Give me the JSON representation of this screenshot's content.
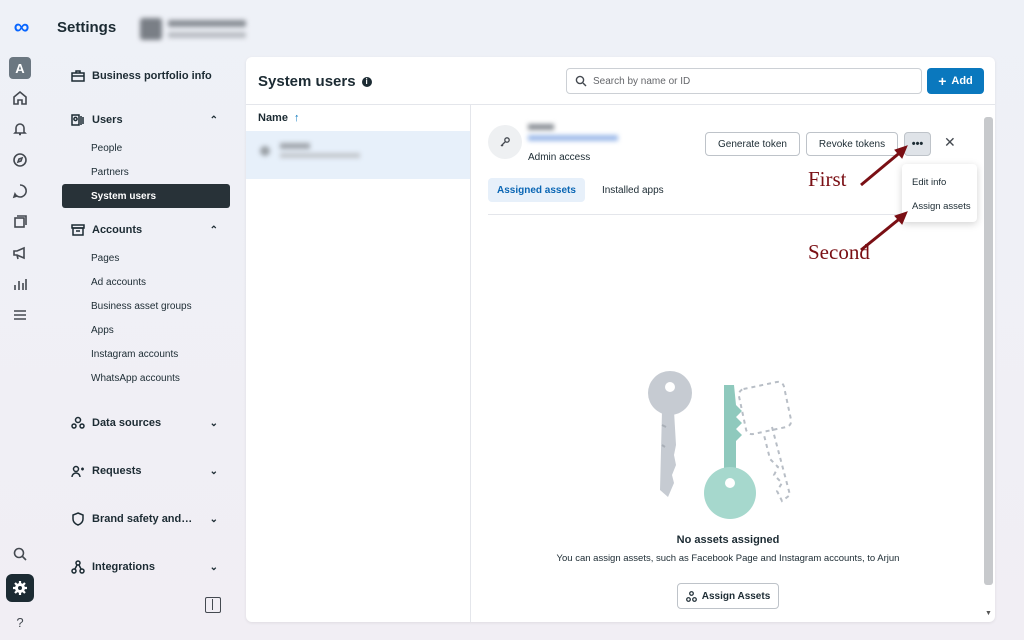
{
  "header": {
    "title": "Settings"
  },
  "sidenav": {
    "sections": [
      {
        "label": "Business portfolio info",
        "icon": "briefcase-icon",
        "chevron": ""
      },
      {
        "label": "Users",
        "icon": "users-icon",
        "chevron": "⌃",
        "items": [
          "People",
          "Partners",
          "System users"
        ]
      },
      {
        "label": "Accounts",
        "icon": "accounts-icon",
        "chevron": "⌃",
        "items": [
          "Pages",
          "Ad accounts",
          "Business asset groups",
          "Apps",
          "Instagram accounts",
          "WhatsApp accounts"
        ]
      },
      {
        "label": "Data sources",
        "icon": "data-sources-icon",
        "chevron": "⌄"
      },
      {
        "label": "Requests",
        "icon": "requests-icon",
        "chevron": "⌄"
      },
      {
        "label": "Brand safety and…",
        "icon": "shield-icon",
        "chevron": "⌄"
      },
      {
        "label": "Integrations",
        "icon": "integrations-icon",
        "chevron": "⌄"
      }
    ],
    "active_item": "System users"
  },
  "rail": {
    "avatar_letter": "A",
    "help_label": "?"
  },
  "main": {
    "title": "System users",
    "search_placeholder": "Search by name or ID",
    "add_label": "Add",
    "list_header": "Name",
    "detail": {
      "role": "Admin access",
      "generate_token": "Generate token",
      "revoke_tokens": "Revoke tokens",
      "more_label": "•••",
      "tabs": [
        "Assigned assets",
        "Installed apps"
      ],
      "empty_title": "No assets assigned",
      "empty_desc": "You can assign assets, such as Facebook Page and Instagram accounts, to Arjun",
      "assign_button": "Assign Assets"
    },
    "menu": {
      "items": [
        "Edit info",
        "Assign assets"
      ]
    }
  },
  "annotations": {
    "first": "First",
    "second": "Second"
  },
  "colors": {
    "primary": "#0a78be",
    "annotation": "#7a0f14",
    "active_nav": "#283238"
  }
}
